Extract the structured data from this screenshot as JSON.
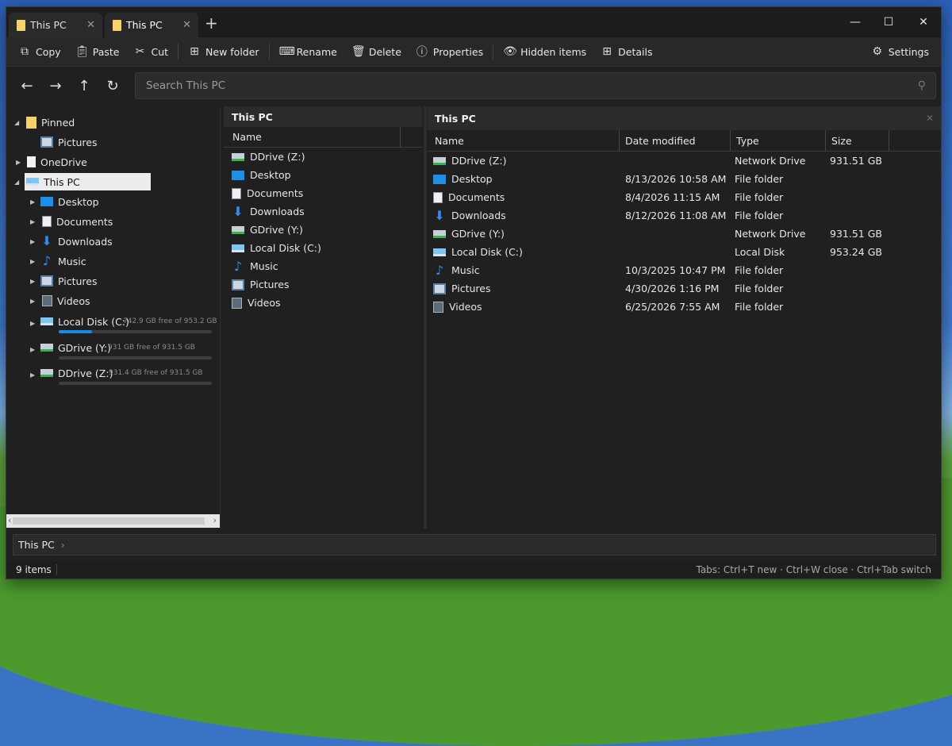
{
  "tabs": [
    {
      "label": "This PC",
      "close": "✕"
    },
    {
      "label": "This PC",
      "close": "✕"
    }
  ],
  "window_controls": {
    "new_tab": "+",
    "minimize": "—",
    "maximize": "☐",
    "close": "✕"
  },
  "toolbar": {
    "copy": "Copy",
    "paste": "Paste",
    "cut": "Cut",
    "new_folder": "New folder",
    "rename": "Rename",
    "delete": "Delete",
    "properties": "Properties",
    "hidden_items": "Hidden items",
    "details": "Details",
    "settings": "Settings"
  },
  "search": {
    "placeholder": "Search This PC"
  },
  "tree": {
    "pinned": "Pinned",
    "pinned_pictures": "Pictures",
    "onedrive": "OneDrive",
    "this_pc": "This PC",
    "desktop": "Desktop",
    "documents": "Documents",
    "downloads": "Downloads",
    "music": "Music",
    "pictures": "Pictures",
    "videos": "Videos",
    "drives": [
      {
        "label": "Local Disk (C:)",
        "free": "742.9 GB free of 953.2 GB",
        "used_fraction": 0.22
      },
      {
        "label": "GDrive (Y:)",
        "free": "931 GB free of 931.5 GB",
        "used_fraction": 0.0
      },
      {
        "label": "DDrive (Z:)",
        "free": "931.4 GB free of 931.5 GB",
        "used_fraction": 0.0
      }
    ]
  },
  "column1": {
    "title": "This PC",
    "name_header": "Name",
    "items": [
      "DDrive (Z:)",
      "Desktop",
      "Documents",
      "Downloads",
      "GDrive (Y:)",
      "Local Disk (C:)",
      "Music",
      "Pictures",
      "Videos"
    ]
  },
  "column2": {
    "title": "This PC",
    "headers": {
      "name": "Name",
      "date": "Date modified",
      "type": "Type",
      "size": "Size"
    },
    "rows": [
      {
        "name": "DDrive (Z:)",
        "date": "",
        "type": "Network Drive",
        "size": "931.51 GB"
      },
      {
        "name": "Desktop",
        "date": "8/13/2026 10:58 AM",
        "type": "File folder",
        "size": ""
      },
      {
        "name": "Documents",
        "date": "8/4/2026 11:15 AM",
        "type": "File folder",
        "size": ""
      },
      {
        "name": "Downloads",
        "date": "8/12/2026 11:08 AM",
        "type": "File folder",
        "size": ""
      },
      {
        "name": "GDrive (Y:)",
        "date": "",
        "type": "Network Drive",
        "size": "931.51 GB"
      },
      {
        "name": "Local Disk (C:)",
        "date": "",
        "type": "Local Disk",
        "size": "953.24 GB"
      },
      {
        "name": "Music",
        "date": "10/3/2025 10:47 PM",
        "type": "File folder",
        "size": ""
      },
      {
        "name": "Pictures",
        "date": "4/30/2026 1:16 PM",
        "type": "File folder",
        "size": ""
      },
      {
        "name": "Videos",
        "date": "6/25/2026 7:55 AM",
        "type": "File folder",
        "size": ""
      }
    ]
  },
  "pathbar": {
    "segment": "This PC"
  },
  "status": {
    "count": "9 items",
    "hint": "Tabs: Ctrl+T new · Ctrl+W close · Ctrl+Tab switch"
  }
}
